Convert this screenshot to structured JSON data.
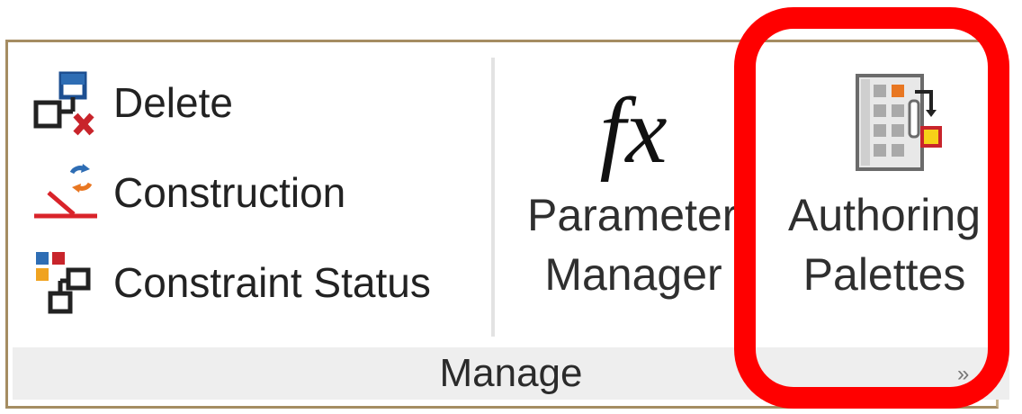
{
  "panel": {
    "title": "Manage",
    "launcher_icon": "dialog-launcher-icon"
  },
  "commands": {
    "delete": {
      "label": "Delete",
      "icon": "delete-constraint-icon"
    },
    "construction": {
      "label": "Construction",
      "icon": "construction-geometry-icon"
    },
    "status": {
      "label": "Constraint Status",
      "icon": "constraint-status-icon"
    }
  },
  "parameters_manager": {
    "icon_text": "fx",
    "line1": "Parameters",
    "line2": "Manager"
  },
  "authoring_palettes": {
    "icon": "authoring-palettes-icon",
    "line1": "Authoring",
    "line2": "Palettes"
  },
  "colors": {
    "highlight": "#ff0000",
    "panel_border": "#a58d62",
    "footer": "#eeeeee"
  },
  "launcher_glyph": "»"
}
